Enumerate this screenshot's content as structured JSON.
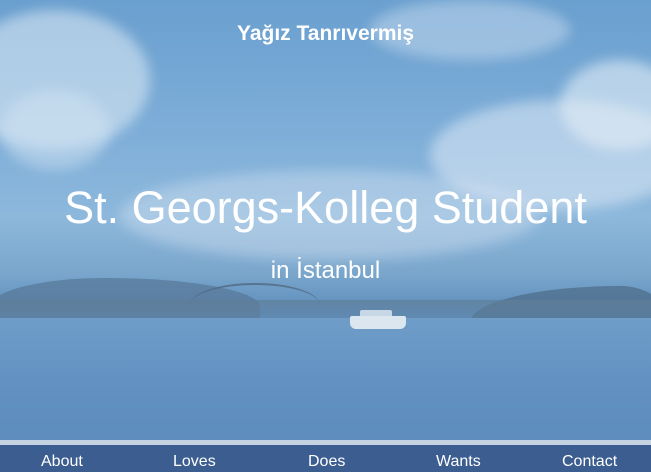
{
  "header": {
    "title": "Yağız Tanrıvermiş"
  },
  "hero": {
    "headline": "St. Georgs-Kolleg Student",
    "subline": "in İstanbul"
  },
  "nav": {
    "items": [
      {
        "label": "About"
      },
      {
        "label": "Loves"
      },
      {
        "label": "Does"
      },
      {
        "label": "Wants"
      },
      {
        "label": "Contact"
      }
    ]
  },
  "colors": {
    "nav_background": "#3c5d8f",
    "nav_border": "#c4d3e4",
    "text": "#ffffff"
  }
}
